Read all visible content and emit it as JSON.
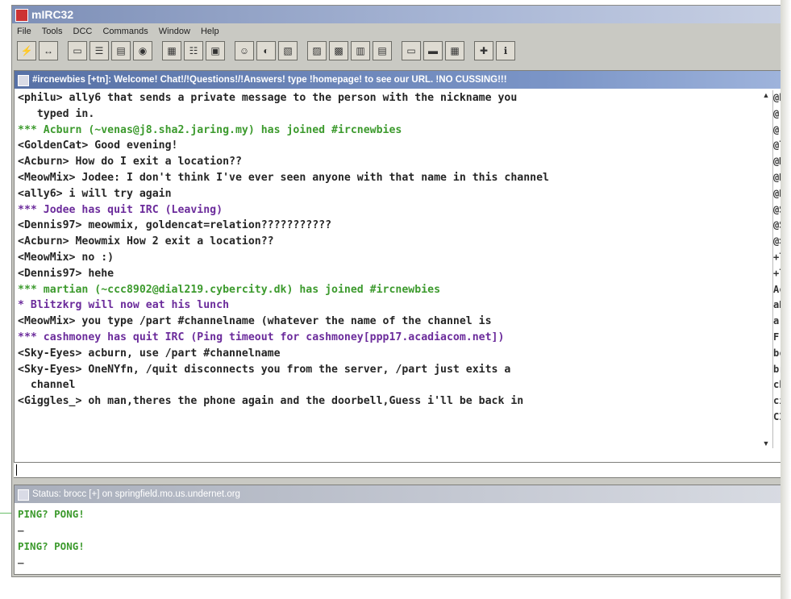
{
  "window": {
    "title": "mIRC32",
    "menu": [
      "File",
      "Tools",
      "DCC",
      "Commands",
      "Window",
      "Help"
    ]
  },
  "toolbar": {
    "icons": [
      "connect-icon",
      "disconnect-icon",
      "folder-icon",
      "options-icon",
      "channel-folder-icon",
      "url-icon",
      "color-icon",
      "list-icon",
      "address-book-icon",
      "chat-icon",
      "send-file-icon",
      "dcc-icon",
      "notify-icon",
      "finger-icon",
      "timer-icon",
      "ident-icon",
      "tile-icon",
      "cascade-icon",
      "arrange-icon",
      "help-icon",
      "about-icon"
    ]
  },
  "channel": {
    "title": "#ircnewbies [+tn]: Welcome! Chat!/!Questions!/!Answers! type !homepage! to see our URL. !NO CUSSING!!!",
    "lines": [
      {
        "text": "<philu> ally6 that sends a private message to the person with the nickname you",
        "color": "black"
      },
      {
        "text": "   typed in.",
        "color": "black"
      },
      {
        "text": "*** Acburn (~venas@j8.sha2.jaring.my) has joined #ircnewbies",
        "color": "green"
      },
      {
        "text": "<GoldenCat> Good evening!",
        "color": "black"
      },
      {
        "text": "<Acburn> How do I exit a location??",
        "color": "black"
      },
      {
        "text": "<MeowMix> Jodee: I don't think I've ever seen anyone with that name in this channel",
        "color": "black"
      },
      {
        "text": "<ally6> i will try again",
        "color": "black"
      },
      {
        "text": "*** Jodee has quit IRC (Leaving)",
        "color": "purple"
      },
      {
        "text": "<Dennis97> meowmix, goldencat=relation???????????",
        "color": "black"
      },
      {
        "text": "<Acburn> Meowmix How 2 exit a location??",
        "color": "black"
      },
      {
        "text": "<MeowMix> no :)",
        "color": "black"
      },
      {
        "text": "<Dennis97> hehe",
        "color": "black"
      },
      {
        "text": "*** martian (~ccc8902@dial219.cybercity.dk) has joined #ircnewbies",
        "color": "green"
      },
      {
        "text": "* Blitzkrg will now eat his lunch",
        "color": "purple"
      },
      {
        "text": "<MeowMix> you type /part #channelname (whatever the name of the channel is",
        "color": "black"
      },
      {
        "text": "*** cashmoney has quit IRC (Ping timeout for cashmoney[ppp17.acadiacom.net])",
        "color": "purple"
      },
      {
        "text": "<Sky-Eyes> acburn, use /part #channelname",
        "color": "black"
      },
      {
        "text": "<Sky-Eyes> OneNYfn, /quit disconnects you from the server, /part just exits a",
        "color": "black"
      },
      {
        "text": "  channel",
        "color": "black"
      },
      {
        "text": "<Giggles_> oh man,theres the phone again and the doorbell,Guess i'll be back in",
        "color": "black"
      }
    ],
    "nicks": [
      "@b",
      "@(",
      "@(",
      "@l",
      "@M",
      "@N",
      "@R",
      "@S",
      "@S",
      "@>",
      "+l",
      "+l",
      "Ac",
      "aD",
      "a]",
      "F",
      "bc",
      "br",
      "ch",
      "ci",
      "CI"
    ]
  },
  "status": {
    "title": "Status: brocc [+] on springfield.mo.us.undernet.org",
    "lines": [
      {
        "text": "PING? PONG!",
        "kind": "green"
      },
      {
        "text": "–",
        "kind": "dash"
      },
      {
        "text": "PING? PONG!",
        "kind": "green"
      },
      {
        "text": "–",
        "kind": "dash"
      }
    ]
  }
}
